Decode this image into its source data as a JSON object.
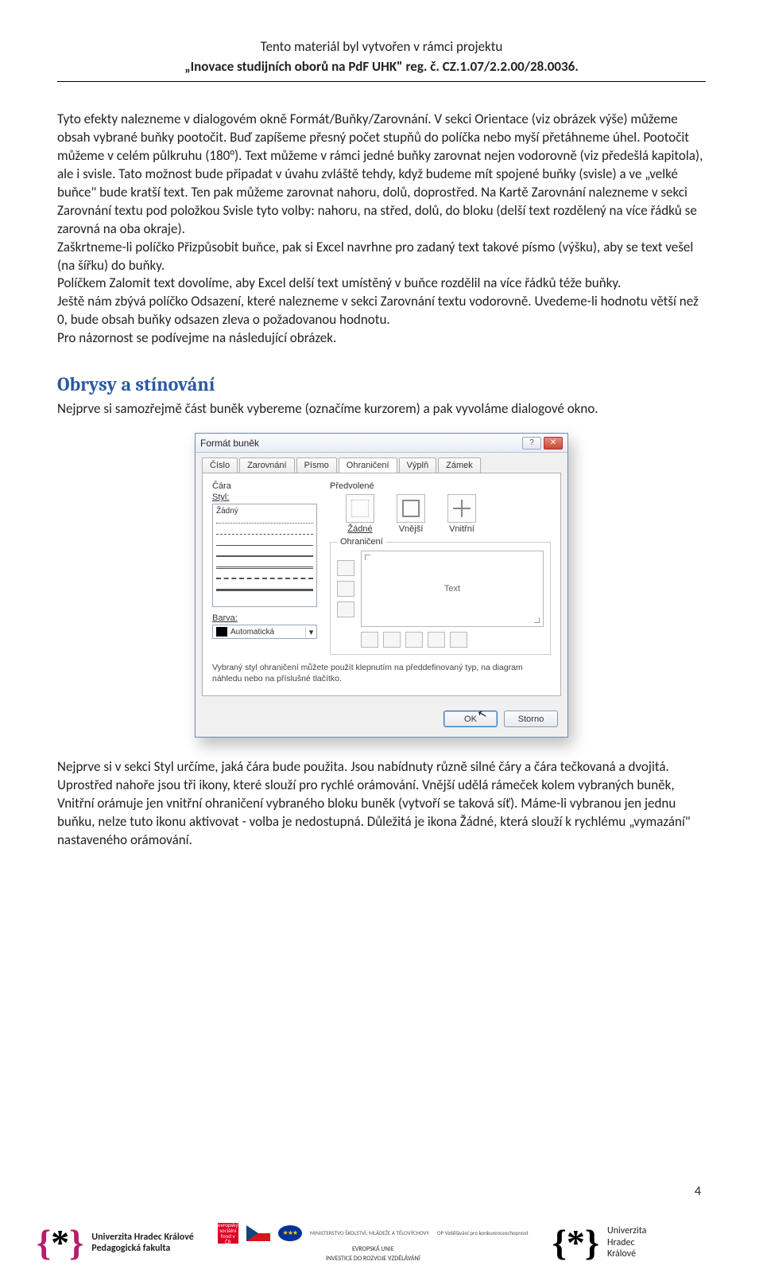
{
  "header": {
    "line1": "Tento materiál byl vytvořen v rámci projektu",
    "line2": "„Inovace studijních oborů na PdF UHK\" reg. č. CZ.1.07/2.2.00/28.0036."
  },
  "body": {
    "p1": "Tyto efekty nalezneme v dialogovém okně Formát/Buňky/Zarovnání. V sekci Orientace (viz obrázek výše) můžeme obsah vybrané buňky pootočit. Buď zapíšeme přesný počet stupňů do políčka nebo myší přetáhneme úhel. Pootočit můžeme v celém půlkruhu (180°).",
    "p2": "Text můžeme v rámci jedné buňky zarovnat nejen vodorovně (viz předešlá kapitola), ale i svisle. Tato možnost bude připadat v úvahu zvláště tehdy, když budeme mít spojené buňky (svisle) a ve „velké buňce\" bude kratší text. Ten pak můžeme zarovnat nahoru, dolů, doprostřed. Na Kartě Zarovnání nalezneme v sekci Zarovnání textu pod položkou Svisle tyto volby: nahoru, na střed, dolů, do bloku (delší text rozdělený na více řádků se zarovná na oba okraje).",
    "p3": "Zaškrtneme-li políčko Přizpůsobit buňce, pak si Excel navrhne pro zadaný text takové písmo (výšku), aby se text vešel (na šířku) do buňky.",
    "p4": "Políčkem Zalomit text dovolíme, aby Excel delší text umístěný v buňce rozdělil na více řádků téže buňky.",
    "p5": "Ještě nám zbývá políčko Odsazení, které nalezneme v sekci Zarovnání textu vodorovně. Uvedeme-li hodnotu větší než 0, bude obsah buňky odsazen zleva o požadovanou hodnotu.",
    "p6": "Pro názornost se podívejme na následující obrázek."
  },
  "section": {
    "title": "Obrysy a stínování",
    "intro": "Nejprve si samozřejmě část buněk vybereme (označíme kurzorem) a pak vyvoláme dialogové okno."
  },
  "dialog": {
    "title": "Formát buněk",
    "tabs": [
      "Číslo",
      "Zarovnání",
      "Písmo",
      "Ohraničení",
      "Výplň",
      "Zámek"
    ],
    "active_tab": "Ohraničení",
    "line_label": "Čára",
    "style_label": "Styl:",
    "style_none": "Žádný",
    "color_label": "Barva:",
    "color_value": "Automatická",
    "presets_label": "Předvolené",
    "preset_none": "Žádné",
    "preset_outer": "Vnější",
    "preset_inner": "Vnitřní",
    "border_group": "Ohraničení",
    "preview_text": "Text",
    "hint": "Vybraný styl ohraničení můžete použít klepnutím na předdefinovaný typ, na diagram náhledu nebo na příslušné tlačítko.",
    "ok": "OK",
    "cancel": "Storno"
  },
  "after": {
    "p1": "Nejprve si v sekci Styl určíme, jaká čára bude použita. Jsou nabídnuty různě silné čáry a čára tečkovaná a dvojitá. Uprostřed nahoře jsou tři ikony, které slouží pro rychlé orámování. Vnější udělá rámeček kolem vybraných buněk, Vnitřní orámuje jen vnitřní ohraničení vybraného bloku buněk (vytvoří se taková síť). Máme-li vybranou jen jednu buňku, nelze tuto ikonu aktivovat - volba je nedostupná. Důležitá je ikona Žádné, která slouží k rychlému „vymazání\" nastaveného orámování."
  },
  "page_number": "4",
  "footer": {
    "uhk_pdf_1": "Univerzita Hradec Králové",
    "uhk_pdf_2": "Pedagogická fakulta",
    "esf": "evropský sociální fond v ČR",
    "eu": "EVROPSKÁ UNIE",
    "msmt": "MINISTERSTVO ŠKOLSTVÍ, MLÁDEŽE A TĚLOVÝCHOVY",
    "opvk": "OP Vzdělávání pro konkurenceschopnost",
    "invest": "INVESTICE DO ROZVOJE VZDĚLÁVÁNÍ",
    "uhk_1": "Univerzita",
    "uhk_2": "Hradec",
    "uhk_3": "Králové"
  }
}
